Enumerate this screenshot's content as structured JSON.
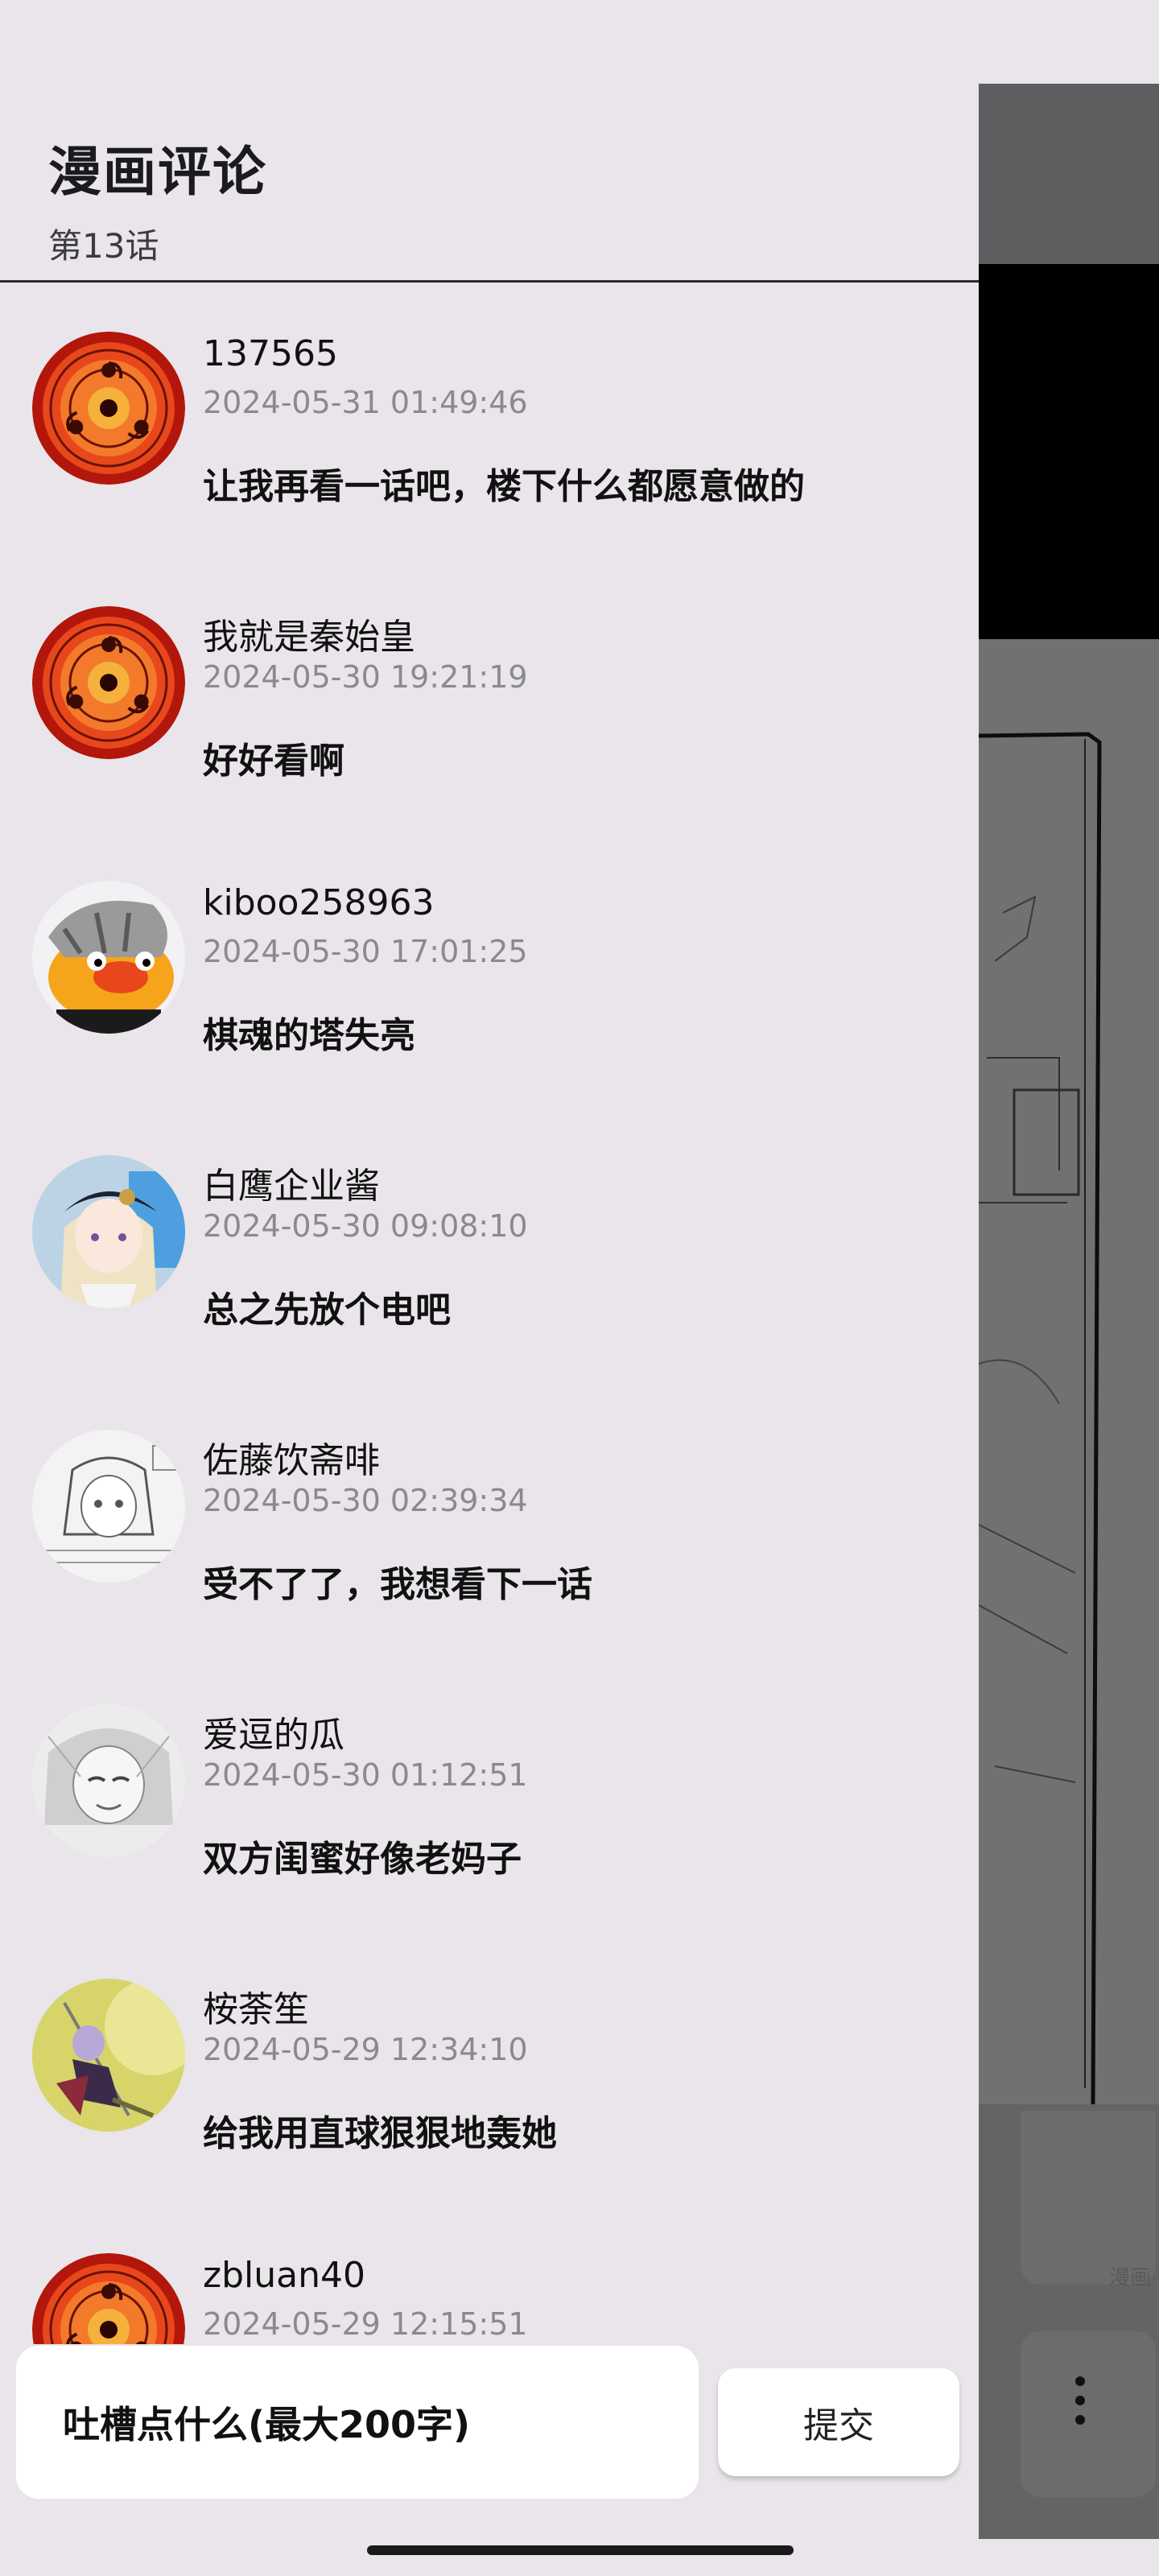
{
  "drawer": {
    "title": "漫画评论",
    "subtitle": "第13话"
  },
  "comments": [
    {
      "user": "137565",
      "time": "2024-05-31 01:49:46",
      "text": "让我再看一话吧，楼下什么都愿意做的",
      "avatar": "sharingan-avatar"
    },
    {
      "user": "我就是秦始皇",
      "time": "2024-05-30 19:21:19",
      "text": "好好看啊",
      "avatar": "sharingan-avatar"
    },
    {
      "user": "kiboo258963",
      "time": "2024-05-30 17:01:25",
      "text": "棋魂的塔失亮",
      "avatar": "duck-avatar"
    },
    {
      "user": "白鹰企业酱",
      "time": "2024-05-30 09:08:10",
      "text": "总之先放个电吧",
      "avatar": "anime-girl-cap-avatar"
    },
    {
      "user": "佐藤饮斋啡",
      "time": "2024-05-30 02:39:34",
      "text": "受不了了，我想看下一话",
      "avatar": "manga-sketch-avatar"
    },
    {
      "user": "爱逗的瓜",
      "time": "2024-05-30 01:12:51",
      "text": "双方闺蜜好像老妈子",
      "avatar": "grey-sketch-avatar"
    },
    {
      "user": "桉荼笙",
      "time": "2024-05-29 12:34:10",
      "text": "给我用直球狠狠地轰她",
      "avatar": "character-art-avatar"
    },
    {
      "user": "zbluan40",
      "time": "2024-05-29 12:15:51",
      "text": "",
      "avatar": "sharingan-avatar"
    }
  ],
  "composer": {
    "placeholder": "吐槽点什么(最大200字)",
    "submit_label": "提交"
  },
  "colors": {
    "background": "#e9e5ea",
    "sharingan_red": "#e8471c",
    "timestamp": "#8a8a8e"
  }
}
